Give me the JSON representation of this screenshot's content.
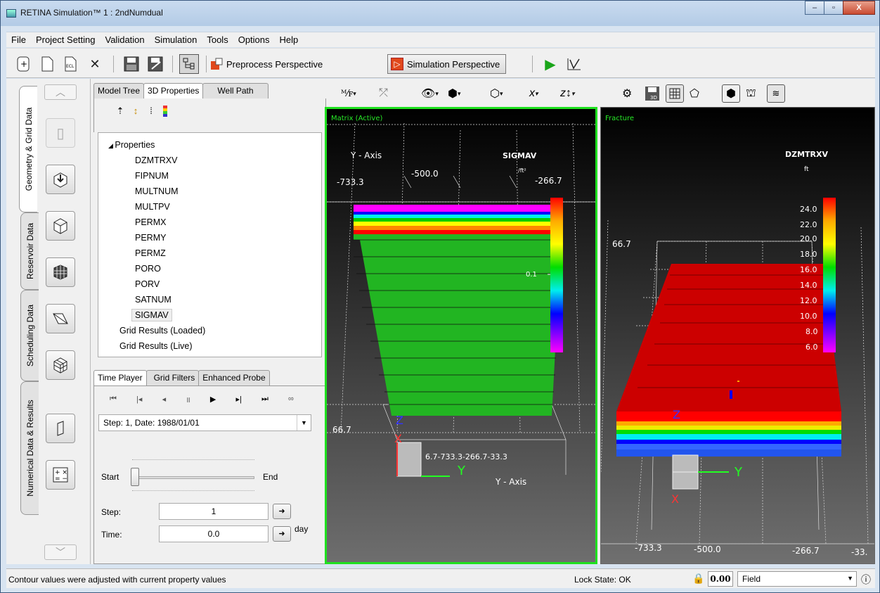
{
  "window": {
    "title": "RETINA Simulation™ 1 : 2ndNumdual",
    "min": "–",
    "max": "▫",
    "close": "X"
  },
  "menu": [
    "File",
    "Project Setting",
    "Validation",
    "Simulation",
    "Tools",
    "Options",
    "Help"
  ],
  "toolbar": {
    "preprocess": "Preprocess Perspective",
    "simulation": "Simulation Perspective",
    "ecl": "ECL"
  },
  "vtabs": [
    "Geometry & Grid Data",
    "Reservoir Data",
    "Scheduling Data",
    "Numerical Data & Results"
  ],
  "panel_tabs": [
    "Model Tree",
    "3D Properties",
    "Well Path"
  ],
  "tree": {
    "root": "Properties",
    "items": [
      "DZMTRXV",
      "FIPNUM",
      "MULTNUM",
      "MULTPV",
      "PERMX",
      "PERMY",
      "PERMZ",
      "PORO",
      "PORV",
      "SATNUM",
      "SIGMAV"
    ],
    "groups": [
      "Grid Results (Loaded)",
      "Grid Results (Live)"
    ],
    "selected": "SIGMAV"
  },
  "bottom_tabs": [
    "Time Player",
    "Grid Filters",
    "Enhanced Probe"
  ],
  "player": {
    "step_combo": "Step: 1, Date: 1988/01/01",
    "start": "Start",
    "end": "End",
    "step_label": "Step:",
    "step_value": "1",
    "time_label": "Time:",
    "time_value": "0.0",
    "time_unit": "day"
  },
  "left_view": {
    "title": "Matrix (Active)",
    "axis_name": "Y - Axis",
    "axis_name_bottom": "Y - Axis",
    "ticks_top": [
      "-733.3",
      "-500.0",
      "-266.7"
    ],
    "tick_left": "66.7",
    "bottom_ticks": "6.7-733.3-266.7-33.3",
    "legend_title": "SIGMAV",
    "legend_unit": "/ft²",
    "legend_values": [
      "0.1"
    ],
    "axes": {
      "x": "X",
      "y": "Y",
      "z": "Z"
    }
  },
  "right_view": {
    "title": "Fracture",
    "legend_title": "DZMTRXV",
    "legend_unit": "ft",
    "legend_values": [
      "24.0",
      "22.0",
      "20.0",
      "18.0",
      "16.0",
      "14.0",
      "12.0",
      "10.0",
      "8.0",
      "6.0"
    ],
    "tick_left": "66.7",
    "bottom_ticks": [
      "-733.3",
      "-500.0",
      "-266.7",
      "-33."
    ],
    "axes": {
      "x": "X",
      "y": "Y",
      "z": "Z"
    }
  },
  "status": {
    "message": "Contour values were adjusted with current property values",
    "lock": "Lock State: OK",
    "value": "0.00",
    "unit_system": "Field"
  },
  "colors": {
    "matrix": "#22b522",
    "fracture": "#cc0000",
    "active_border": "#1fe11f"
  }
}
